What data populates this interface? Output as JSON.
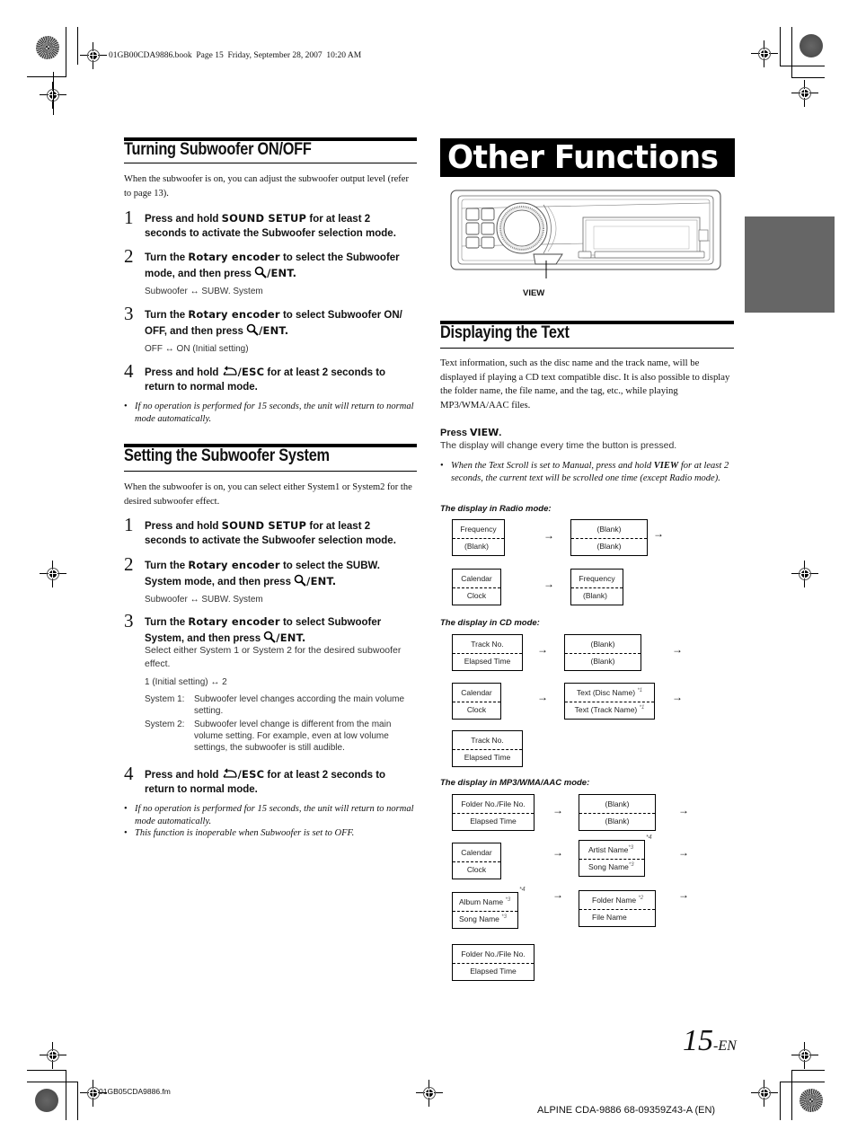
{
  "print_header": "01GB00CDA9886.book  Page 15  Friday, September 28, 2007  10:20 AM",
  "print_footer_file": "01GB05CDA9886.fm",
  "left": {
    "section1": {
      "title": "Turning Subwoofer ON/OFF",
      "intro": "When the subwoofer is on, you can adjust the subwoofer output level (refer to page 13).",
      "steps": [
        {
          "num": "1",
          "pre": "Press and hold ",
          "key": "SOUND SETUP",
          "post": " for at least 2 seconds to activate the Subwoofer selection mode."
        },
        {
          "num": "2",
          "pre": "Turn the ",
          "key": "Rotary encoder",
          "post": " to select the Subwoofer mode, and then press ",
          "icon": "search-icon",
          "end": "/ENT.",
          "sub": "Subwoofer ↔ SUBW. System"
        },
        {
          "num": "3",
          "pre": "Turn the ",
          "key": "Rotary encoder",
          "post": " to select Subwoofer ON/ OFF, and then press ",
          "icon": "search-icon",
          "end": "/ENT.",
          "sub": "OFF ↔ ON (Initial setting)"
        },
        {
          "num": "4",
          "pre": "Press and hold ",
          "icon": "return-icon",
          "end": "/ESC",
          "post": " for at least 2 seconds to return to normal mode."
        }
      ],
      "notes": [
        "If no operation is performed for 15 seconds, the unit will return to normal mode automatically."
      ]
    },
    "section2": {
      "title": "Setting the Subwoofer System",
      "intro": "When the subwoofer is on, you can select either System1 or System2 for the desired subwoofer effect.",
      "steps": [
        {
          "num": "1",
          "pre": "Press and hold ",
          "key": "SOUND SETUP",
          "post": " for at least 2 seconds to activate the Subwoofer selection mode."
        },
        {
          "num": "2",
          "pre": "Turn the ",
          "key": "Rotary encoder",
          "post": " to select the SUBW. System mode, and then press ",
          "icon": "search-icon",
          "end": "/ENT.",
          "sub": "Subwoofer ↔ SUBW. System"
        },
        {
          "num": "3",
          "pre": "Turn the ",
          "key": "Rotary encoder",
          "post": " to select Subwoofer System, and then press ",
          "icon": "search-icon",
          "end": "/ENT.",
          "desc": "Select either System 1 or System 2 for the desired subwoofer effect.",
          "sub": "1 (Initial setting) ↔ 2",
          "defs": [
            {
              "term": "System 1:",
              "def": "Subwoofer level changes according the main volume setting."
            },
            {
              "term": "System 2:",
              "def": "Subwoofer level change is different from the main volume setting. For example, even at low volume settings, the subwoofer is still audible."
            }
          ]
        },
        {
          "num": "4",
          "pre": "Press and hold ",
          "icon": "return-icon",
          "end": "/ESC",
          "post": " for at least 2 seconds to return to normal mode."
        }
      ],
      "notes": [
        "If no operation is performed for 15 seconds, the unit will return to normal mode automatically.",
        "This function is inoperable when Subwoofer is set to OFF."
      ]
    }
  },
  "right": {
    "chapter_title": "Other Functions",
    "figure_label": "VIEW",
    "section": {
      "title": "Displaying the Text",
      "intro": "Text information, such as the disc name and the track name, will be displayed if playing a CD text compatible disc. It is also possible to display the folder name, the file name, and the tag, etc., while playing MP3/WMA/AAC files.",
      "press_pre": "Press ",
      "press_key": "VIEW",
      "press_post": ".",
      "press_desc": "The display will change every time the button is pressed.",
      "note_pre": "When the Text Scroll is set to Manual, press and hold ",
      "note_key": "VIEW",
      "note_post": " for at least 2 seconds, the current text will be scrolled one time (except Radio mode)."
    },
    "diagrams": {
      "radio": {
        "label": "The display in Radio mode:",
        "boxes": [
          {
            "top": "Frequency",
            "bottom": "(Blank)"
          },
          {
            "top": "(Blank)",
            "bottom": "(Blank)"
          },
          {
            "top": "Calendar",
            "bottom": "Clock"
          },
          {
            "top": "Frequency",
            "bottom": "(Blank)"
          }
        ]
      },
      "cd": {
        "label": "The display in CD mode:",
        "boxes": [
          {
            "top": "Track No.",
            "bottom": "Elapsed Time"
          },
          {
            "top": "(Blank)",
            "bottom": "(Blank)"
          },
          {
            "top": "Calendar",
            "bottom": "Clock"
          },
          {
            "top": "Text (Disc Name)",
            "top_fn": "*1",
            "bottom": "Text (Track Name)",
            "bottom_fn": "*1"
          },
          {
            "top": "Track No.",
            "bottom": "Elapsed Time"
          }
        ]
      },
      "mp3": {
        "label": "The display in MP3/WMA/AAC mode:",
        "boxes": [
          {
            "top": "Folder No./File No.",
            "bottom": "Elapsed Time"
          },
          {
            "top": "(Blank)",
            "bottom": "(Blank)"
          },
          {
            "top": "Calendar",
            "bottom": "Clock"
          },
          {
            "top": "Artist Name",
            "top_fn": "*3",
            "bottom": "Song Name",
            "bottom_fn": "*3",
            "ext": "*4"
          },
          {
            "top": "Album Name",
            "top_fn": "*3",
            "bottom": "Song Name",
            "bottom_fn": "*3",
            "ext": "*4"
          },
          {
            "top": "Folder Name",
            "top_fn": "*2",
            "bottom": "File Name"
          },
          {
            "top": "Folder No./File No.",
            "bottom": "Elapsed Time"
          }
        ]
      },
      "arrow": "→"
    }
  },
  "page_number": "15",
  "page_suffix": "-EN",
  "footer": "ALPINE CDA-9886 68-09359Z43-A (EN)"
}
